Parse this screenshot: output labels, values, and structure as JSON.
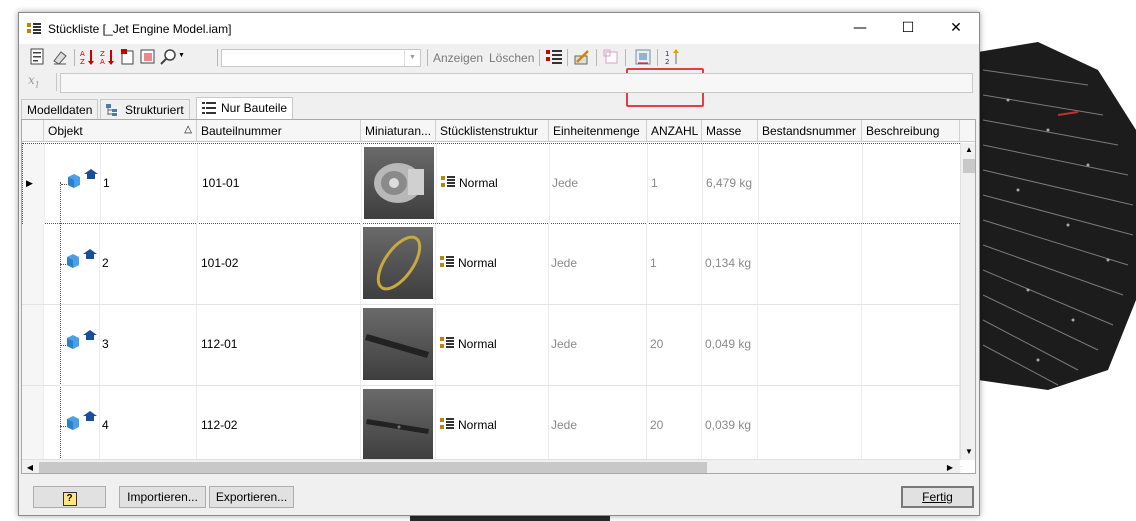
{
  "window": {
    "title": "Stückliste [_Jet Engine Model.iam]",
    "minimize": "—",
    "maximize": "☐",
    "close": "✕"
  },
  "toolbar": {
    "combo_value": "",
    "show_label": "Anzeigen",
    "delete_label": "Löschen"
  },
  "formula_bar": {
    "fx_label": "x",
    "value": ""
  },
  "tabs": [
    {
      "label": "Modelldaten"
    },
    {
      "label": "Strukturiert"
    },
    {
      "label": "Nur Bauteile"
    }
  ],
  "columns": {
    "objekt": "Objekt",
    "sort_marker": "△",
    "bauteilnummer": "Bauteilnummer",
    "miniatur": "Miniaturan...",
    "struktur": "Stücklistenstruktur",
    "einheit": "Einheitenmenge",
    "anzahl": "ANZAHL",
    "masse": "Masse",
    "bestand": "Bestandsnummer",
    "beschreibung": "Beschreibung"
  },
  "rows": [
    {
      "item": "1",
      "part": "101-01",
      "structure": "Normal",
      "unit": "Jede",
      "qty": "1",
      "mass": "6,479 kg"
    },
    {
      "item": "2",
      "part": "101-02",
      "structure": "Normal",
      "unit": "Jede",
      "qty": "1",
      "mass": "0,134 kg"
    },
    {
      "item": "3",
      "part": "112-01",
      "structure": "Normal",
      "unit": "Jede",
      "qty": "20",
      "mass": "0,049 kg"
    },
    {
      "item": "4",
      "part": "112-02",
      "structure": "Normal",
      "unit": "Jede",
      "qty": "20",
      "mass": "0,039 kg"
    }
  ],
  "bottom": {
    "help_label": "?",
    "import_label": "Importieren...",
    "export_label": "Exportieren...",
    "finish_label": "Fertig"
  },
  "colors": {
    "highlight_box": "#e04040",
    "window_bg": "#f0f0f0"
  }
}
